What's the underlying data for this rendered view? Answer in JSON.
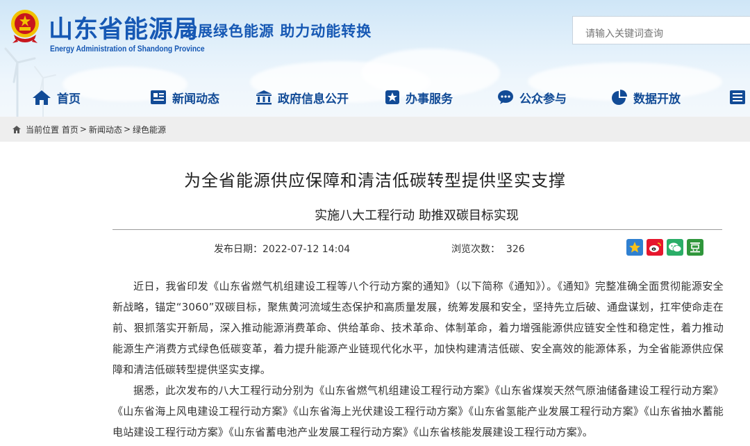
{
  "site": {
    "name_cn": "山东省能源局",
    "name_en": "Energy Administration of Shandong Province",
    "slogan": "发展绿色能源  助力动能转换"
  },
  "search": {
    "placeholder": "请输入关键词查询"
  },
  "nav": {
    "items": [
      {
        "label": "首页",
        "icon": "home-icon"
      },
      {
        "label": "新闻动态",
        "icon": "newspaper-icon"
      },
      {
        "label": "政府信息公开",
        "icon": "government-building-icon"
      },
      {
        "label": "办事服务",
        "icon": "star-badge-icon"
      },
      {
        "label": "公众参与",
        "icon": "speech-bubble-icon"
      },
      {
        "label": "数据开放",
        "icon": "pie-chart-icon"
      },
      {
        "label": "",
        "icon": "document-list-icon"
      }
    ]
  },
  "breadcrumb": {
    "prefix": "当前位置",
    "items": [
      "首页",
      "新闻动态",
      "绿色能源"
    ],
    "separator": ">"
  },
  "article": {
    "title": "为全省能源供应保障和清洁低碳转型提供坚实支撑",
    "subtitle": "实施八大工程行动 助推双碳目标实现",
    "publish_label": "发布日期：",
    "publish_date": "2022-07-12 14:04",
    "views_label": "浏览次数：",
    "views": "326",
    "share": [
      {
        "name": "qzone-share-icon",
        "color": "#f0b400"
      },
      {
        "name": "weibo-share-icon",
        "color": "#e6162d"
      },
      {
        "name": "wechat-share-icon",
        "color": "#2aae67"
      },
      {
        "name": "douban-share-icon",
        "color": "#2f963b"
      }
    ],
    "paragraphs": [
      "近日，我省印发《山东省燃气机组建设工程等八个行动方案的通知》（以下简称《通知》）。《通知》完整准确全面贯彻能源安全新战略，锚定“3060”双碳目标，聚焦黄河流域生态保护和高质量发展，统筹发展和安全，坚持先立后破、通盘谋划，扛牢使命走在前、狠抓落实开新局，深入推动能源消费革命、供给革命、技术革命、体制革命，着力增强能源供应链安全性和稳定性，着力推动能源生产消费方式绿色低碳变革，着力提升能源产业链现代化水平，加快构建清洁低碳、安全高效的能源体系，为全省能源供应保障和清洁低碳转型提供坚实支撑。",
      "据悉，此次发布的八大工程行动分别为《山东省燃气机组建设工程行动方案》《山东省煤炭天然气原油储备建设工程行动方案》《山东省海上风电建设工程行动方案》《山东省海上光伏建设工程行动方案》《山东省氢能产业发展工程行动方案》《山东省抽水蓄能电站建设工程行动方案》《山东省蓄电池产业发展工程行动方案》《山东省核能发展建设工程行动方案》。"
    ]
  },
  "colors": {
    "brand_blue": "#1658b4",
    "nav_blue": "#124b96",
    "emblem_red": "#c8161d",
    "emblem_gold": "#f2c200"
  }
}
